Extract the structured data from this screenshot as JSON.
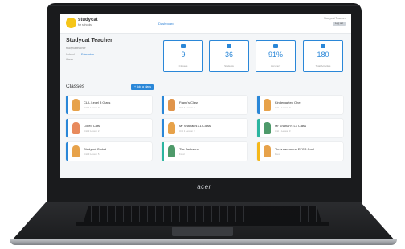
{
  "colors": {
    "accent": "#2a87d8",
    "brand_yellow": "#f5c518",
    "bar_blue": "#2a87d8",
    "bar_teal": "#2bb5a0",
    "bar_yellow": "#f5b81b"
  },
  "laptop": {
    "brand": "acer"
  },
  "app": {
    "logo_title": "studycat",
    "logo_subtitle": "for schools",
    "nav_link": "Dashboard",
    "user_label": "Studycat Teacher",
    "logout_label": "Log out"
  },
  "teacher": {
    "name": "Studycat Teacher",
    "username": "studycatteacher",
    "school_label": "School",
    "school_value": "Edmonton",
    "class_label": "Class"
  },
  "stats": [
    {
      "value": "9",
      "label": "Classes",
      "icon": "classes-icon"
    },
    {
      "value": "36",
      "label": "Students",
      "icon": "students-icon"
    },
    {
      "value": "91%",
      "label": "Accuracy",
      "icon": "accuracy-icon"
    },
    {
      "value": "180",
      "label": "Total Activities",
      "icon": "activities-icon"
    }
  ],
  "classes_section": {
    "heading": "Classes",
    "add_label": "+ Add a class"
  },
  "classes": [
    {
      "name": "CLIL Level 3 Class",
      "sub": "Unit 1 Lesson 3",
      "bar": "blue"
    },
    {
      "name": "Frank's Class",
      "sub": "Unit 1 Lesson 3",
      "bar": "blue"
    },
    {
      "name": "Kindergarten One",
      "sub": "Unit 1 Lesson 3",
      "bar": "blue"
    },
    {
      "name": "Lolled Cats",
      "sub": "Unit 2 Lesson 2",
      "bar": "blue"
    },
    {
      "name": "Mr Shahan's L1 Class",
      "sub": "Unit 1 Lesson 3",
      "bar": "blue"
    },
    {
      "name": "Mr Shahan's L3 Class",
      "sub": "Unit 1 Lesson 3",
      "bar": "teal"
    },
    {
      "name": "Studycat Global",
      "sub": "Unit 3 Lesson 5",
      "bar": "blue"
    },
    {
      "name": "The Jacksons",
      "sub": "Food",
      "bar": "teal"
    },
    {
      "name": "Tim's Awesome EFCS Cool",
      "sub": "Food",
      "bar": "yellow"
    }
  ]
}
